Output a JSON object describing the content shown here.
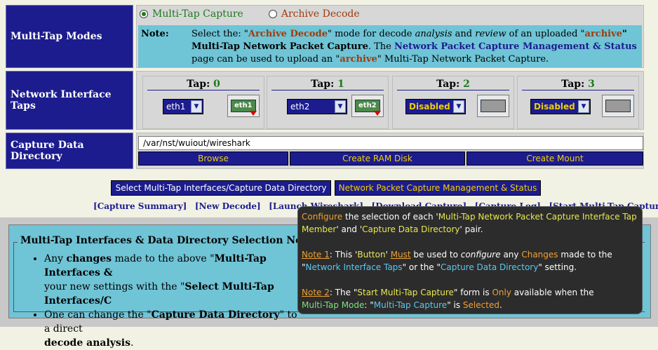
{
  "modes": {
    "header": "Multi-Tap Modes",
    "option_capture": "Multi-Tap Capture",
    "option_decode": "Archive Decode",
    "note_label": "Note:",
    "note_1": "Select the: \"",
    "note_2": "Archive Decode",
    "note_3": "\" mode for decode ",
    "note_4": "analysis",
    "note_5": " and ",
    "note_6": "review",
    "note_7": " of an uploaded \"",
    "note_8": "archive",
    "note_9": "\" Multi-Tap Network Packet Capture",
    "note_10": ". The ",
    "note_11": "Network Packet Capture Management & Status",
    "note_12": " page can be used to upload an \"",
    "note_13": "archive",
    "note_14": "\" Multi-Tap Network Packet Capture."
  },
  "taps": {
    "header": "Network Interface Taps",
    "label": "Tap:",
    "items": [
      {
        "num": "0",
        "value": "eth1",
        "nic": "eth1"
      },
      {
        "num": "1",
        "value": "eth2",
        "nic": "eth2"
      },
      {
        "num": "2",
        "value": "Disabled",
        "nic": ""
      },
      {
        "num": "3",
        "value": "Disabled",
        "nic": ""
      }
    ]
  },
  "directory": {
    "header": "Capture Data Directory",
    "path": "/var/nst/wuiout/wireshark",
    "browse": "Browse",
    "ram_disk": "Create RAM Disk",
    "mount": "Create Mount"
  },
  "actions": {
    "select": "Select Multi-Tap Interfaces/Capture Data Directory",
    "management": "Network Packet Capture Management & Status"
  },
  "links": [
    "Capture Summary",
    "New Decode",
    "Launch Wireshark",
    "Download Capture",
    "Capture Log",
    "Start Multi-Tap Capture"
  ],
  "notes": {
    "legend": "Multi-Tap Interfaces & Data Directory Selection Notes",
    "b1_1": "Any ",
    "b1_2": "changes",
    "b1_3": " made to the above \"",
    "b1_4": "Multi-Tap Interfaces &",
    "b1_5": "your new settings with the \"",
    "b1_6": "Select Multi-Tap Interfaces/C",
    "b2_1": "One can change the \"",
    "b2_2": "Capture Data Directory",
    "b2_3": "\" to a direct",
    "b2_4": "decode analysis",
    "b2_5": "."
  },
  "tooltip": {
    "p1_1": "Configure",
    "p1_2": " the selection of each '",
    "p1_3": "Multi-Tap Network Packet Capture Interface Tap Member",
    "p1_4": "' and '",
    "p1_5": "Capture Data Directory",
    "p1_6": "' pair.",
    "p2_1": "Note 1",
    "p2_2": ":  This '",
    "p2_3": "Button",
    "p2_4": "' ",
    "p2_5": "Must",
    "p2_6": " be used to ",
    "p2_7": "configure",
    "p2_8": " any ",
    "p2_9": "Changes",
    "p2_10": " made to the \"",
    "p2_11": "Network Interface Taps",
    "p2_12": "\" or the \"",
    "p2_13": "Capture Data Directory",
    "p2_14": "\" setting.",
    "p3_1": "Note 2",
    "p3_2": ":  The \"",
    "p3_3": "Start Multi-Tap Capture",
    "p3_4": "\" form is ",
    "p3_5": "Only",
    "p3_6": " available when the ",
    "p3_7": "Multi-Tap Mode",
    "p3_8": ": \"",
    "p3_9": "Multi-Tap Capture",
    "p3_10": "\" is ",
    "p3_11": "Selected",
    "p3_12": "."
  }
}
